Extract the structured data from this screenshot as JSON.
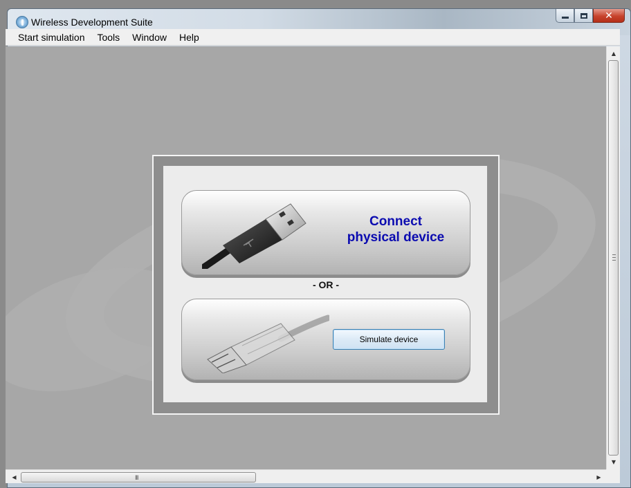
{
  "window": {
    "title": "Wireless Development Suite",
    "icon": "app-antenna-icon"
  },
  "menu": {
    "items": [
      "Start simulation",
      "Tools",
      "Window",
      "Help"
    ]
  },
  "panel": {
    "connect_label_line1": "Connect",
    "connect_label_line2": "physical device",
    "or_text": "- OR -",
    "simulate_button": "Simulate device",
    "connect_icon": "usb-cable-icon",
    "simulate_icon": "transparent-usb-cable-icon"
  },
  "scrollbars": {
    "h_grip": "III"
  },
  "colors": {
    "connect_text": "#0b0bb0",
    "close_button": "#c7432c",
    "simulate_border": "#3c7fb1"
  }
}
